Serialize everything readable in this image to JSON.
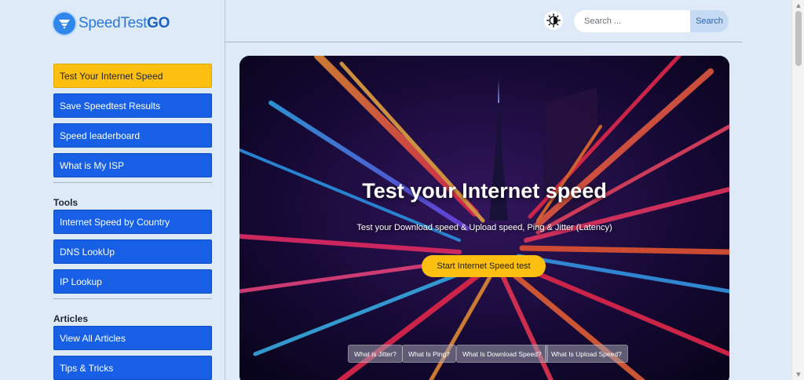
{
  "brand": {
    "name_part1": "SpeedTest",
    "name_part2": "GO"
  },
  "sidebar": {
    "primary": [
      {
        "label": "Test Your Internet Speed",
        "active": true
      },
      {
        "label": "Save Speedtest Results"
      },
      {
        "label": "Speed leaderboard"
      },
      {
        "label": "What is My ISP"
      }
    ],
    "tools_heading": "Tools",
    "tools": [
      {
        "label": "Internet Speed by Country"
      },
      {
        "label": "DNS LookUp"
      },
      {
        "label": "IP Lookup"
      }
    ],
    "articles_heading": "Articles",
    "articles": [
      {
        "label": "View All Articles"
      },
      {
        "label": "Tips & Tricks"
      }
    ]
  },
  "header": {
    "theme_icon": "contrast-icon",
    "search_placeholder": "Search ...",
    "search_button": "Search"
  },
  "hero": {
    "title": "Test your Internet speed",
    "subtitle": "Test your Download speed & Upload speed, Ping & Jitter (Latency)",
    "cta": "Start Internet Speed test",
    "chips": [
      "What is Jitter?",
      "What Is Ping?",
      "What Is Download Speed?",
      "What Is Upload Speed?"
    ]
  },
  "colors": {
    "accent": "#1760e6",
    "active": "#fdc010",
    "background": "#deeaf7"
  }
}
